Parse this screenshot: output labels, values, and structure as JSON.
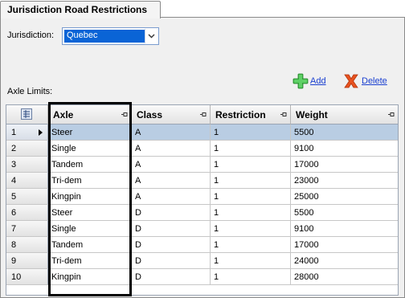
{
  "tab": {
    "label": "Jurisdiction Road Restrictions"
  },
  "jurisdiction": {
    "label": "Jurisdiction:",
    "value": "Quebec"
  },
  "axle_limits_label": "Axle Limits:",
  "actions": {
    "add_label": "Add",
    "delete_label": "Delete"
  },
  "grid": {
    "columns": [
      "Axle",
      "Class",
      "Restriction",
      "Weight"
    ],
    "rows": [
      {
        "num": "1",
        "axle": "Steer",
        "class": "A",
        "restriction": "1",
        "weight": "5500"
      },
      {
        "num": "2",
        "axle": "Single",
        "class": "A",
        "restriction": "1",
        "weight": "9100"
      },
      {
        "num": "3",
        "axle": "Tandem",
        "class": "A",
        "restriction": "1",
        "weight": "17000"
      },
      {
        "num": "4",
        "axle": "Tri-dem",
        "class": "A",
        "restriction": "1",
        "weight": "23000"
      },
      {
        "num": "5",
        "axle": "Kingpin",
        "class": "A",
        "restriction": "1",
        "weight": "25000"
      },
      {
        "num": "6",
        "axle": "Steer",
        "class": "D",
        "restriction": "1",
        "weight": "5500"
      },
      {
        "num": "7",
        "axle": "Single",
        "class": "D",
        "restriction": "1",
        "weight": "9100"
      },
      {
        "num": "8",
        "axle": "Tandem",
        "class": "D",
        "restriction": "1",
        "weight": "17000"
      },
      {
        "num": "9",
        "axle": "Tri-dem",
        "class": "D",
        "restriction": "1",
        "weight": "24000"
      },
      {
        "num": "10",
        "axle": "Kingpin",
        "class": "D",
        "restriction": "1",
        "weight": "28000"
      }
    ],
    "selected_row": "1"
  },
  "icons": {
    "column_chooser": "column-chooser-icon",
    "pin": "pin-icon",
    "add": "plus-icon",
    "delete": "x-icon",
    "dropdown": "chevron-down-icon",
    "row_pointer": "row-pointer-icon"
  },
  "colors": {
    "selection": "#0a64d6",
    "selected_row": "#b9cde3",
    "link": "#1a3fd0",
    "add_icon": "#3cb043",
    "delete_icon": "#e0401a"
  }
}
